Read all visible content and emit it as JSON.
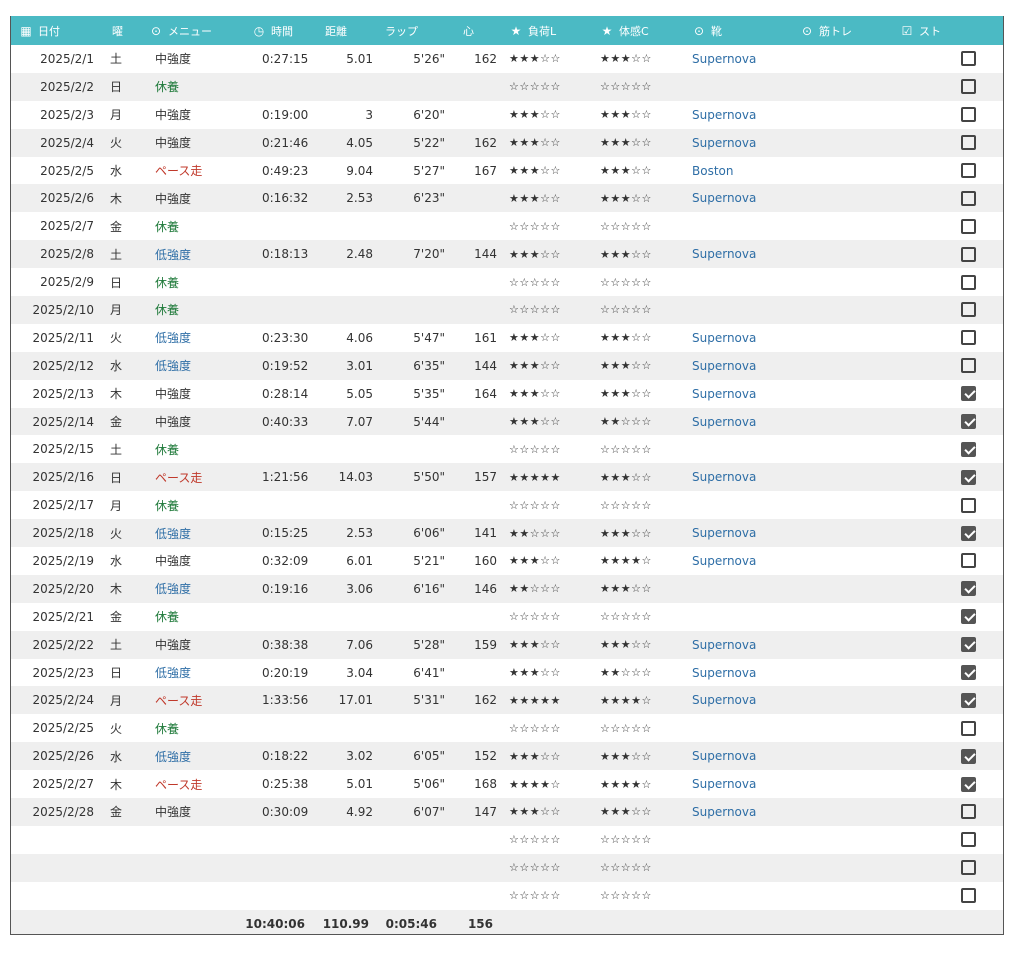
{
  "columns": [
    {
      "icon": "calendar-icon",
      "glyph": "▦",
      "label": "日付"
    },
    {
      "icon": "",
      "glyph": "",
      "label": "曜"
    },
    {
      "icon": "dropdown-circle-icon",
      "glyph": "⊙",
      "label": "メニュー"
    },
    {
      "icon": "clock-icon",
      "glyph": "◷",
      "label": "時間"
    },
    {
      "icon": "",
      "glyph": "",
      "label": "距離"
    },
    {
      "icon": "",
      "glyph": "",
      "label": "ラップ"
    },
    {
      "icon": "",
      "glyph": "",
      "label": "心"
    },
    {
      "icon": "star-icon",
      "glyph": "★",
      "label": "負荷L"
    },
    {
      "icon": "star-icon",
      "glyph": "★",
      "label": "体感C"
    },
    {
      "icon": "dropdown-circle-icon",
      "glyph": "⊙",
      "label": "靴"
    },
    {
      "icon": "dropdown-circle-icon",
      "glyph": "⊙",
      "label": "筋トレ"
    },
    {
      "icon": "checkbox-icon",
      "glyph": "☑",
      "label": "スト"
    }
  ],
  "menu_colors": {
    "中強度": "m-mid",
    "休養": "m-rest",
    "低強度": "m-low",
    "ペース走": "m-pace"
  },
  "rows": [
    {
      "date": "2025/2/1",
      "dow": "土",
      "menu": "中強度",
      "time": "0:27:15",
      "dist": "5.01",
      "lap": "5'26\"",
      "hr": "162",
      "load": "★★★☆☆",
      "cond": "★★★☆☆",
      "shoe": "Supernova",
      "str": "",
      "chk": false
    },
    {
      "date": "2025/2/2",
      "dow": "日",
      "menu": "休養",
      "time": "",
      "dist": "",
      "lap": "",
      "hr": "",
      "load": "☆☆☆☆☆",
      "cond": "☆☆☆☆☆",
      "shoe": "",
      "str": "",
      "chk": false
    },
    {
      "date": "2025/2/3",
      "dow": "月",
      "menu": "中強度",
      "time": "0:19:00",
      "dist": "3",
      "lap": "6'20\"",
      "hr": "",
      "load": "★★★☆☆",
      "cond": "★★★☆☆",
      "shoe": "Supernova",
      "str": "",
      "chk": false
    },
    {
      "date": "2025/2/4",
      "dow": "火",
      "menu": "中強度",
      "time": "0:21:46",
      "dist": "4.05",
      "lap": "5'22\"",
      "hr": "162",
      "load": "★★★☆☆",
      "cond": "★★★☆☆",
      "shoe": "Supernova",
      "str": "",
      "chk": false
    },
    {
      "date": "2025/2/5",
      "dow": "水",
      "menu": "ペース走",
      "time": "0:49:23",
      "dist": "9.04",
      "lap": "5'27\"",
      "hr": "167",
      "load": "★★★☆☆",
      "cond": "★★★☆☆",
      "shoe": "Boston",
      "str": "",
      "chk": false
    },
    {
      "date": "2025/2/6",
      "dow": "木",
      "menu": "中強度",
      "time": "0:16:32",
      "dist": "2.53",
      "lap": "6'23\"",
      "hr": "",
      "load": "★★★☆☆",
      "cond": "★★★☆☆",
      "shoe": "Supernova",
      "str": "",
      "chk": false
    },
    {
      "date": "2025/2/7",
      "dow": "金",
      "menu": "休養",
      "time": "",
      "dist": "",
      "lap": "",
      "hr": "",
      "load": "☆☆☆☆☆",
      "cond": "☆☆☆☆☆",
      "shoe": "",
      "str": "",
      "chk": false
    },
    {
      "date": "2025/2/8",
      "dow": "土",
      "menu": "低強度",
      "time": "0:18:13",
      "dist": "2.48",
      "lap": "7'20\"",
      "hr": "144",
      "load": "★★★☆☆",
      "cond": "★★★☆☆",
      "shoe": "Supernova",
      "str": "",
      "chk": false
    },
    {
      "date": "2025/2/9",
      "dow": "日",
      "menu": "休養",
      "time": "",
      "dist": "",
      "lap": "",
      "hr": "",
      "load": "☆☆☆☆☆",
      "cond": "☆☆☆☆☆",
      "shoe": "",
      "str": "",
      "chk": false
    },
    {
      "date": "2025/2/10",
      "dow": "月",
      "menu": "休養",
      "time": "",
      "dist": "",
      "lap": "",
      "hr": "",
      "load": "☆☆☆☆☆",
      "cond": "☆☆☆☆☆",
      "shoe": "",
      "str": "",
      "chk": false
    },
    {
      "date": "2025/2/11",
      "dow": "火",
      "menu": "低強度",
      "time": "0:23:30",
      "dist": "4.06",
      "lap": "5'47\"",
      "hr": "161",
      "load": "★★★☆☆",
      "cond": "★★★☆☆",
      "shoe": "Supernova",
      "str": "",
      "chk": false
    },
    {
      "date": "2025/2/12",
      "dow": "水",
      "menu": "低強度",
      "time": "0:19:52",
      "dist": "3.01",
      "lap": "6'35\"",
      "hr": "144",
      "load": "★★★☆☆",
      "cond": "★★★☆☆",
      "shoe": "Supernova",
      "str": "",
      "chk": false
    },
    {
      "date": "2025/2/13",
      "dow": "木",
      "menu": "中強度",
      "time": "0:28:14",
      "dist": "5.05",
      "lap": "5'35\"",
      "hr": "164",
      "load": "★★★☆☆",
      "cond": "★★★☆☆",
      "shoe": "Supernova",
      "str": "",
      "chk": true
    },
    {
      "date": "2025/2/14",
      "dow": "金",
      "menu": "中強度",
      "time": "0:40:33",
      "dist": "7.07",
      "lap": "5'44\"",
      "hr": "",
      "load": "★★★☆☆",
      "cond": "★★☆☆☆",
      "shoe": "Supernova",
      "str": "",
      "chk": true
    },
    {
      "date": "2025/2/15",
      "dow": "土",
      "menu": "休養",
      "time": "",
      "dist": "",
      "lap": "",
      "hr": "",
      "load": "☆☆☆☆☆",
      "cond": "☆☆☆☆☆",
      "shoe": "",
      "str": "",
      "chk": true
    },
    {
      "date": "2025/2/16",
      "dow": "日",
      "menu": "ペース走",
      "time": "1:21:56",
      "dist": "14.03",
      "lap": "5'50\"",
      "hr": "157",
      "load": "★★★★★",
      "cond": "★★★☆☆",
      "shoe": "Supernova",
      "str": "",
      "chk": true
    },
    {
      "date": "2025/2/17",
      "dow": "月",
      "menu": "休養",
      "time": "",
      "dist": "",
      "lap": "",
      "hr": "",
      "load": "☆☆☆☆☆",
      "cond": "☆☆☆☆☆",
      "shoe": "",
      "str": "",
      "chk": false
    },
    {
      "date": "2025/2/18",
      "dow": "火",
      "menu": "低強度",
      "time": "0:15:25",
      "dist": "2.53",
      "lap": "6'06\"",
      "hr": "141",
      "load": "★★☆☆☆",
      "cond": "★★★☆☆",
      "shoe": "Supernova",
      "str": "",
      "chk": true
    },
    {
      "date": "2025/2/19",
      "dow": "水",
      "menu": "中強度",
      "time": "0:32:09",
      "dist": "6.01",
      "lap": "5'21\"",
      "hr": "160",
      "load": "★★★☆☆",
      "cond": "★★★★☆",
      "shoe": "Supernova",
      "str": "",
      "chk": false
    },
    {
      "date": "2025/2/20",
      "dow": "木",
      "menu": "低強度",
      "time": "0:19:16",
      "dist": "3.06",
      "lap": "6'16\"",
      "hr": "146",
      "load": "★★☆☆☆",
      "cond": "★★★☆☆",
      "shoe": "",
      "str": "",
      "chk": true
    },
    {
      "date": "2025/2/21",
      "dow": "金",
      "menu": "休養",
      "time": "",
      "dist": "",
      "lap": "",
      "hr": "",
      "load": "☆☆☆☆☆",
      "cond": "☆☆☆☆☆",
      "shoe": "",
      "str": "",
      "chk": true
    },
    {
      "date": "2025/2/22",
      "dow": "土",
      "menu": "中強度",
      "time": "0:38:38",
      "dist": "7.06",
      "lap": "5'28\"",
      "hr": "159",
      "load": "★★★☆☆",
      "cond": "★★★☆☆",
      "shoe": "Supernova",
      "str": "",
      "chk": true
    },
    {
      "date": "2025/2/23",
      "dow": "日",
      "menu": "低強度",
      "time": "0:20:19",
      "dist": "3.04",
      "lap": "6'41\"",
      "hr": "",
      "load": "★★★☆☆",
      "cond": "★★☆☆☆",
      "shoe": "Supernova",
      "str": "",
      "chk": true
    },
    {
      "date": "2025/2/24",
      "dow": "月",
      "menu": "ペース走",
      "time": "1:33:56",
      "dist": "17.01",
      "lap": "5'31\"",
      "hr": "162",
      "load": "★★★★★",
      "cond": "★★★★☆",
      "shoe": "Supernova",
      "str": "",
      "chk": true
    },
    {
      "date": "2025/2/25",
      "dow": "火",
      "menu": "休養",
      "time": "",
      "dist": "",
      "lap": "",
      "hr": "",
      "load": "☆☆☆☆☆",
      "cond": "☆☆☆☆☆",
      "shoe": "",
      "str": "",
      "chk": false
    },
    {
      "date": "2025/2/26",
      "dow": "水",
      "menu": "低強度",
      "time": "0:18:22",
      "dist": "3.02",
      "lap": "6'05\"",
      "hr": "152",
      "load": "★★★☆☆",
      "cond": "★★★☆☆",
      "shoe": "Supernova",
      "str": "",
      "chk": true
    },
    {
      "date": "2025/2/27",
      "dow": "木",
      "menu": "ペース走",
      "time": "0:25:38",
      "dist": "5.01",
      "lap": "5'06\"",
      "hr": "168",
      "load": "★★★★☆",
      "cond": "★★★★☆",
      "shoe": "Supernova",
      "str": "",
      "chk": true
    },
    {
      "date": "2025/2/28",
      "dow": "金",
      "menu": "中強度",
      "time": "0:30:09",
      "dist": "4.92",
      "lap": "6'07\"",
      "hr": "147",
      "load": "★★★☆☆",
      "cond": "★★★☆☆",
      "shoe": "Supernova",
      "str": "",
      "chk": false
    },
    {
      "date": "",
      "dow": "",
      "menu": "",
      "time": "",
      "dist": "",
      "lap": "",
      "hr": "",
      "load": "☆☆☆☆☆",
      "cond": "☆☆☆☆☆",
      "shoe": "",
      "str": "",
      "chk": false
    },
    {
      "date": "",
      "dow": "",
      "menu": "",
      "time": "",
      "dist": "",
      "lap": "",
      "hr": "",
      "load": "☆☆☆☆☆",
      "cond": "☆☆☆☆☆",
      "shoe": "",
      "str": "",
      "chk": false
    },
    {
      "date": "",
      "dow": "",
      "menu": "",
      "time": "",
      "dist": "",
      "lap": "",
      "hr": "",
      "load": "☆☆☆☆☆",
      "cond": "☆☆☆☆☆",
      "shoe": "",
      "str": "",
      "chk": false
    }
  ],
  "totals": {
    "time": "10:40:06",
    "dist": "110.99",
    "lap": "0:05:46",
    "hr": "156"
  }
}
